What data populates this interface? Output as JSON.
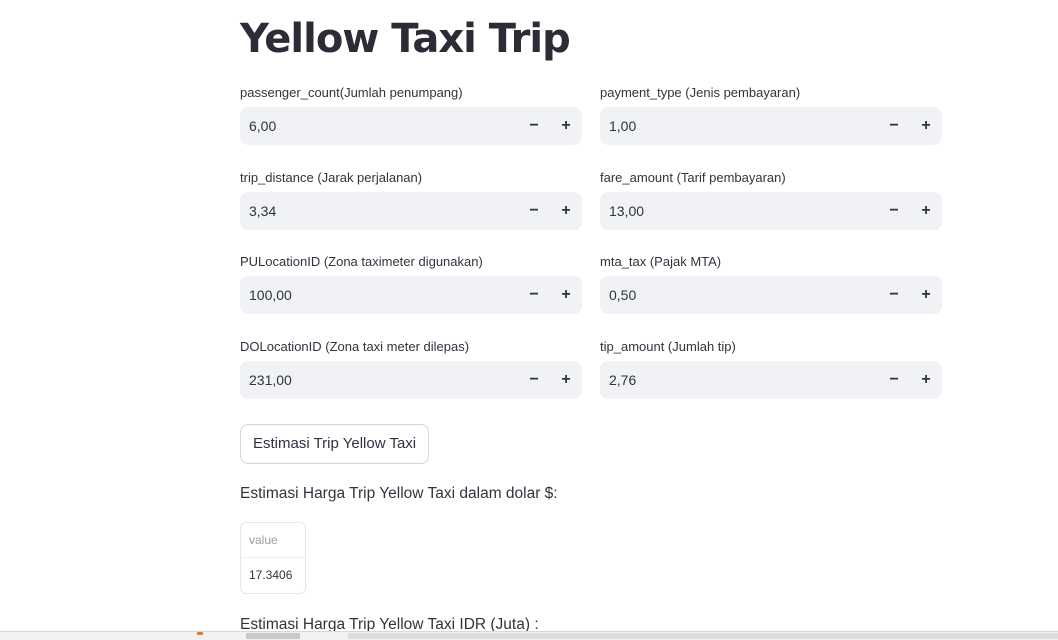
{
  "app": {
    "title": "Yellow Taxi Trip"
  },
  "fields": [
    {
      "label": "passenger_count(Jumlah penumpang)",
      "value": "6,00",
      "minus": "−",
      "plus": "+"
    },
    {
      "label": "payment_type (Jenis pembayaran)",
      "value": "1,00",
      "minus": "−",
      "plus": "+"
    },
    {
      "label": "trip_distance (Jarak perjalanan)",
      "value": "3,34",
      "minus": "−",
      "plus": "+"
    },
    {
      "label": "fare_amount (Tarif pembayaran)",
      "value": "13,00",
      "minus": "−",
      "plus": "+"
    },
    {
      "label": "PULocationID (Zona taximeter digunakan)",
      "value": "100,00",
      "minus": "−",
      "plus": "+"
    },
    {
      "label": "mta_tax (Pajak MTA)",
      "value": "0,50",
      "minus": "−",
      "plus": "+"
    },
    {
      "label": "DOLocationID (Zona taxi meter dilepas)",
      "value": "231,00",
      "minus": "−",
      "plus": "+"
    },
    {
      "label": "tip_amount (Jumlah tip)",
      "value": "2,76",
      "minus": "−",
      "plus": "+"
    }
  ],
  "button": {
    "label": "Estimasi Trip Yellow Taxi"
  },
  "result_usd": {
    "label": "Estimasi Harga Trip Yellow Taxi dalam dolar $:",
    "column_header": "value",
    "cell_value": "17.3406"
  },
  "result_idr": {
    "label": "Estimasi Harga Trip Yellow Taxi IDR (Juta) :"
  }
}
